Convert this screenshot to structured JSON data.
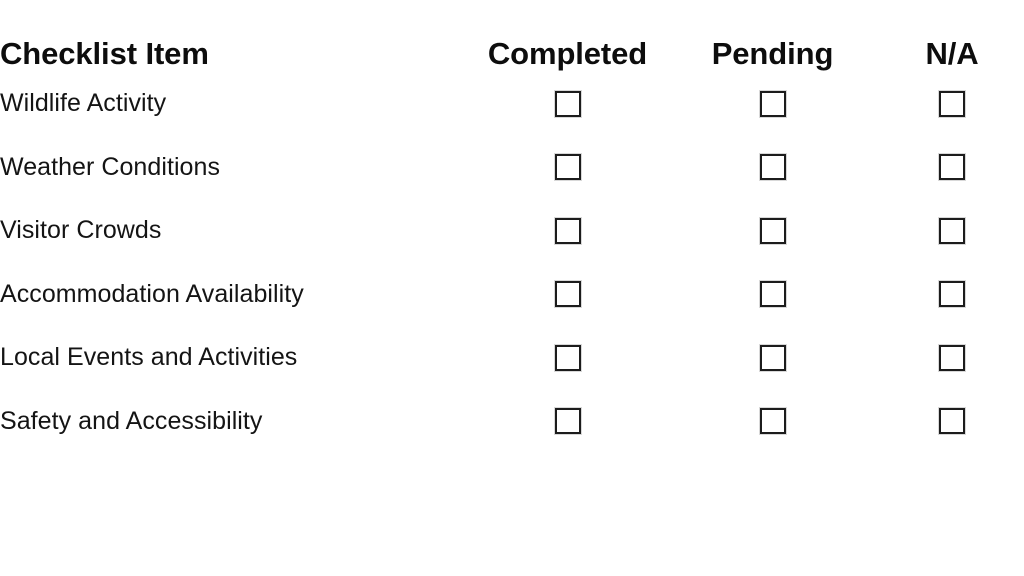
{
  "table": {
    "columns": [
      {
        "key": "item",
        "label": "Checklist Item"
      },
      {
        "key": "completed",
        "label": "Completed"
      },
      {
        "key": "pending",
        "label": "Pending"
      },
      {
        "key": "na",
        "label": "N/A"
      }
    ],
    "rows": [
      {
        "label": "Wildlife Activity",
        "completed": false,
        "pending": false,
        "na": false
      },
      {
        "label": "Weather Conditions",
        "completed": false,
        "pending": false,
        "na": false
      },
      {
        "label": "Visitor Crowds",
        "completed": false,
        "pending": false,
        "na": false
      },
      {
        "label": "Accommodation Availability",
        "completed": false,
        "pending": false,
        "na": false
      },
      {
        "label": "Local Events and Activities",
        "completed": false,
        "pending": false,
        "na": false
      },
      {
        "label": "Safety and Accessibility",
        "completed": false,
        "pending": false,
        "na": false
      }
    ]
  },
  "style": {
    "background": "#ffffff",
    "text_color": "#141414",
    "heading_color": "#0d0d0d",
    "checkbox_border": "#1c1c1c",
    "checkbox_fill": "#ffffff",
    "checkbox_halo": "#d8d8d8"
  },
  "icons": {
    "checkbox": "checkbox-empty-icon"
  }
}
